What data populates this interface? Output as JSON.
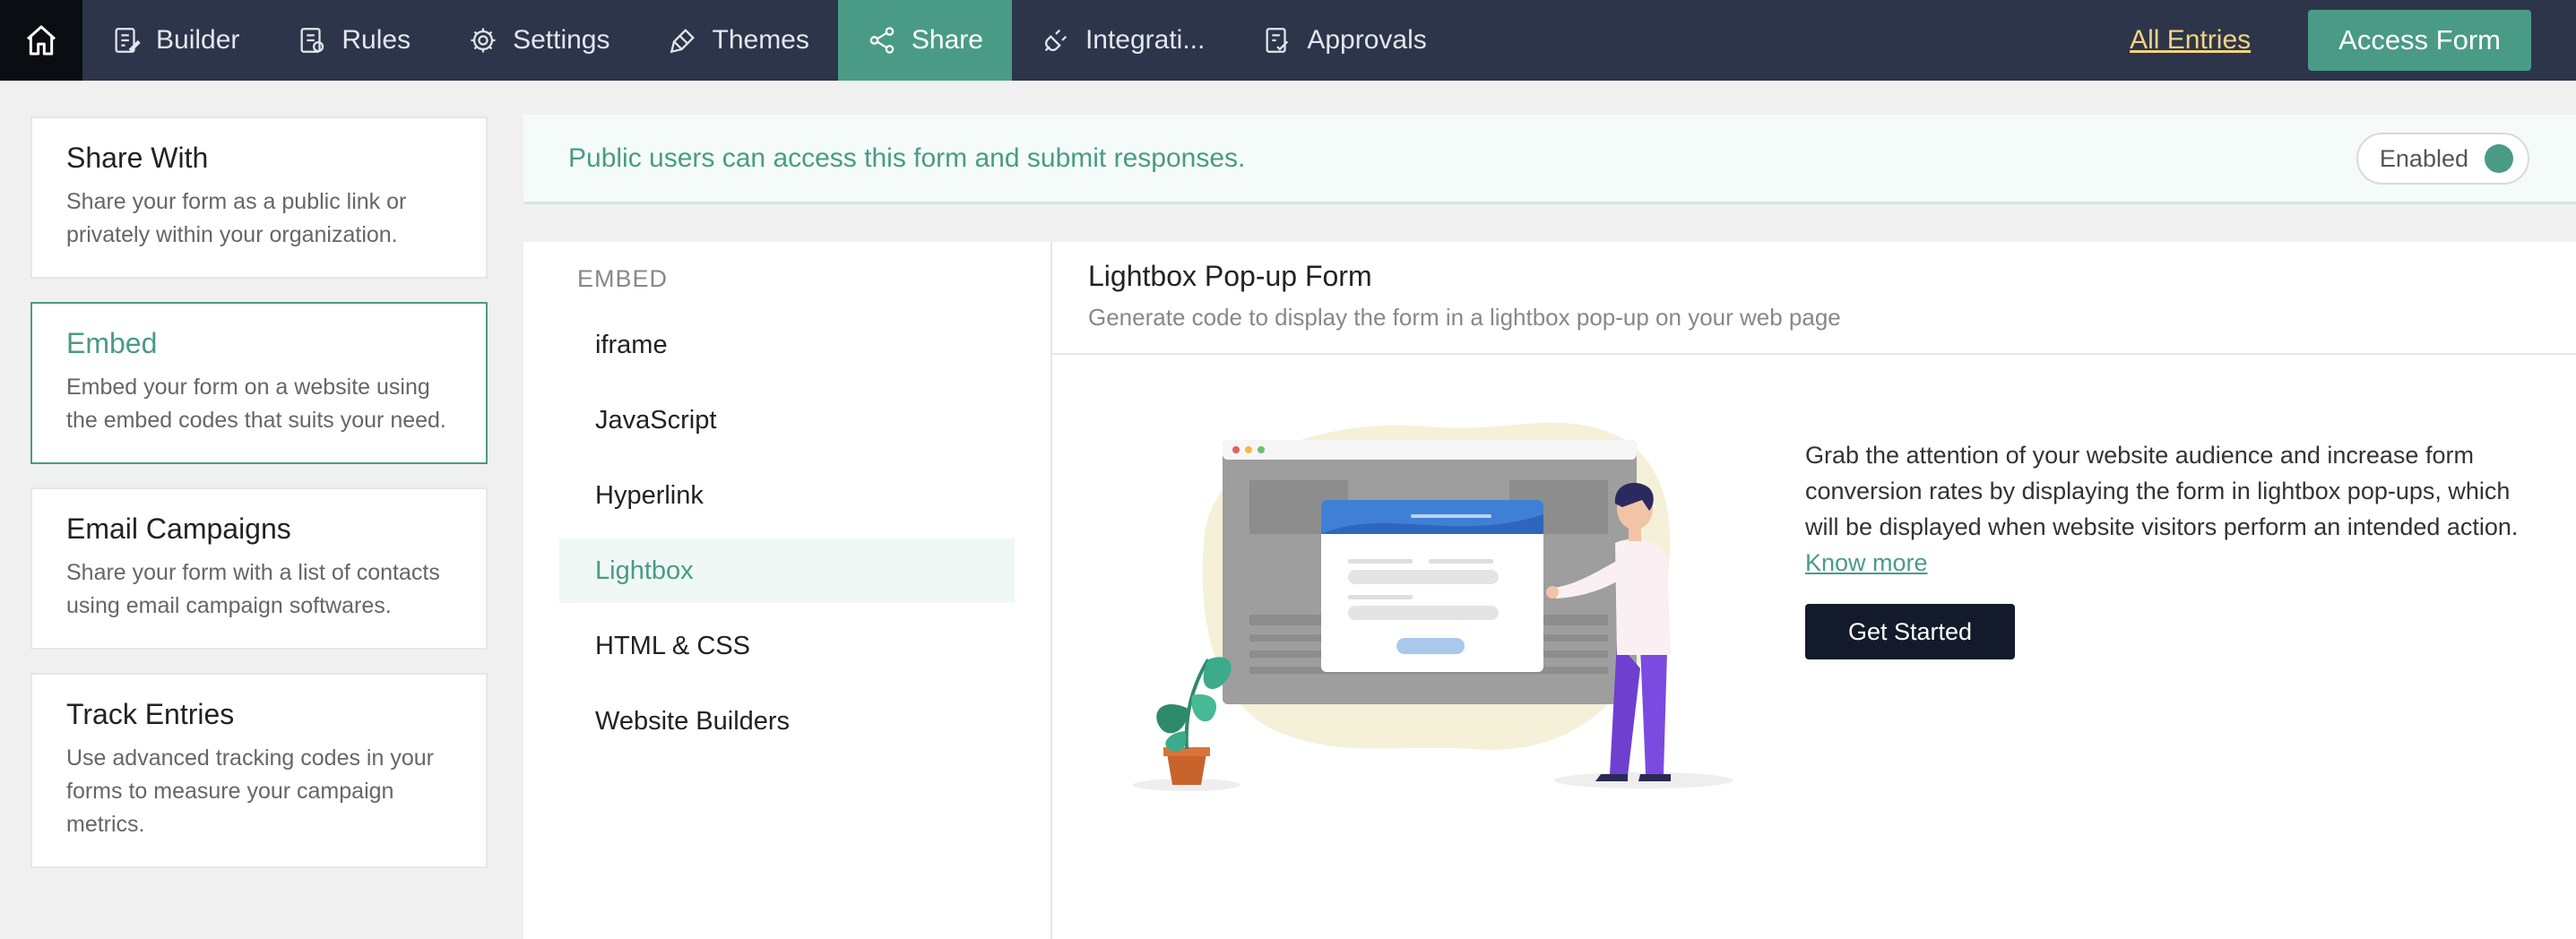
{
  "nav": {
    "items": [
      {
        "label": "Builder",
        "icon": "builder-icon"
      },
      {
        "label": "Rules",
        "icon": "rules-icon"
      },
      {
        "label": "Settings",
        "icon": "gear-icon"
      },
      {
        "label": "Themes",
        "icon": "brush-icon"
      },
      {
        "label": "Share",
        "icon": "share-icon",
        "active": true
      },
      {
        "label": "Integrati...",
        "icon": "plug-icon"
      },
      {
        "label": "Approvals",
        "icon": "approvals-icon"
      }
    ],
    "all_entries_label": "All Entries",
    "access_form_label": "Access Form"
  },
  "left_panel": {
    "cards": [
      {
        "title": "Share With",
        "desc": "Share your form as a public link or privately within your organization."
      },
      {
        "title": "Embed",
        "desc": "Embed your form on a website using the embed codes that suits your need.",
        "active": true
      },
      {
        "title": "Email Campaigns",
        "desc": "Share your form with a list of contacts using email campaign softwares."
      },
      {
        "title": "Track Entries",
        "desc": "Use advanced tracking codes in your forms to measure your campaign metrics."
      }
    ]
  },
  "banner": {
    "text": "Public users can access this form and submit responses.",
    "toggle_label": "Enabled"
  },
  "embed_menu": {
    "heading": "EMBED",
    "items": [
      {
        "label": "iframe"
      },
      {
        "label": "JavaScript"
      },
      {
        "label": "Hyperlink"
      },
      {
        "label": "Lightbox",
        "active": true
      },
      {
        "label": "HTML & CSS"
      },
      {
        "label": "Website Builders"
      }
    ]
  },
  "content": {
    "title": "Lightbox Pop-up Form",
    "subtitle": "Generate code to display the form in a lightbox pop-up on your web page",
    "description": "Grab the attention of your website audience and increase form conversion rates by displaying the form in lightbox pop-ups, which will be displayed when website visitors perform an intended action.",
    "know_more_label": "Know more",
    "get_started_label": "Get Started"
  },
  "colors": {
    "nav_bg": "#2c3549",
    "accent": "#4a9b86",
    "link_yellow": "#f3d383",
    "dark_button": "#121a2b"
  }
}
